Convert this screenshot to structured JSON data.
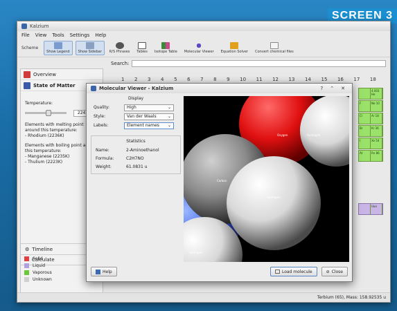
{
  "screen_label": "SCREEN 3",
  "window": {
    "title": "Kalzium",
    "menu": [
      "File",
      "View",
      "Tools",
      "Settings",
      "Help"
    ]
  },
  "toolbar": {
    "scheme_label": "Scheme",
    "items": [
      "Show Legend",
      "Show Sidebar",
      "R/S Phrases",
      "Tables",
      "Isotope Table",
      "Molecular Viewer",
      "Equation Solver",
      "Convert chemical files"
    ]
  },
  "search": {
    "label": "Search:"
  },
  "sidebar": {
    "overview": "Overview",
    "state_of_matter": "State of Matter",
    "temperature_label": "Temperature:",
    "temperature_value": "2242 K",
    "melting_text": "Elements with melting point around this temperature:",
    "melting_items": [
      "- Rhodium (2236K)"
    ],
    "boiling_text": "Elements with boiling point around this temperature:",
    "boiling_items": [
      "- Manganese (2235K)",
      "- Thulium (2223K)"
    ],
    "timeline": "Timeline",
    "calculate": "Calculate"
  },
  "legend": {
    "items": [
      {
        "label": "Solid",
        "color": "#e04040"
      },
      {
        "label": "Liquid",
        "color": "#b0a0e0"
      },
      {
        "label": "Vaporous",
        "color": "#6ac83a"
      },
      {
        "label": "Unknown",
        "color": "#d0d0d0"
      }
    ]
  },
  "periodic_header": [
    "1",
    "2",
    "3",
    "4",
    "5",
    "6",
    "7",
    "8",
    "9",
    "10",
    "11",
    "12",
    "13",
    "14",
    "15",
    "16",
    "17",
    "18"
  ],
  "elements_right": [
    {
      "a": "",
      "b": "4.003\nHe"
    },
    {
      "a": "F",
      "b": "Ne\n10"
    },
    {
      "a": "Cl",
      "b": "Ar\n18"
    },
    {
      "a": "Br",
      "b": "Kr\n36"
    },
    {
      "a": "I",
      "b": "Xe\n54"
    },
    {
      "a": "At",
      "b": "Rn\n86"
    },
    {
      "a": "",
      "b": "Uuo"
    }
  ],
  "statusbar": "Terbium (65), Mass: 158.92535 u",
  "dialog": {
    "title": "Molecular Viewer - Kalzium",
    "display_group": "Display",
    "quality_label": "Quality:",
    "quality_value": "High",
    "style_label": "Style:",
    "style_value": "Van der Waals",
    "labels_label": "Labels:",
    "labels_value": "Element names",
    "statistics_group": "Statistics",
    "name_label": "Name:",
    "name_value": "2-Aminoethanol",
    "formula_label": "Formula:",
    "formula_value": "C2H7NO",
    "weight_label": "Weight:",
    "weight_value": "61.0831 u",
    "help_button": "Help",
    "load_button": "Load molecule",
    "close_button": "Close",
    "atoms": [
      "Oxygen",
      "Hydrogen",
      "Carbon",
      "Hydrogen",
      "Hydrogen"
    ]
  }
}
